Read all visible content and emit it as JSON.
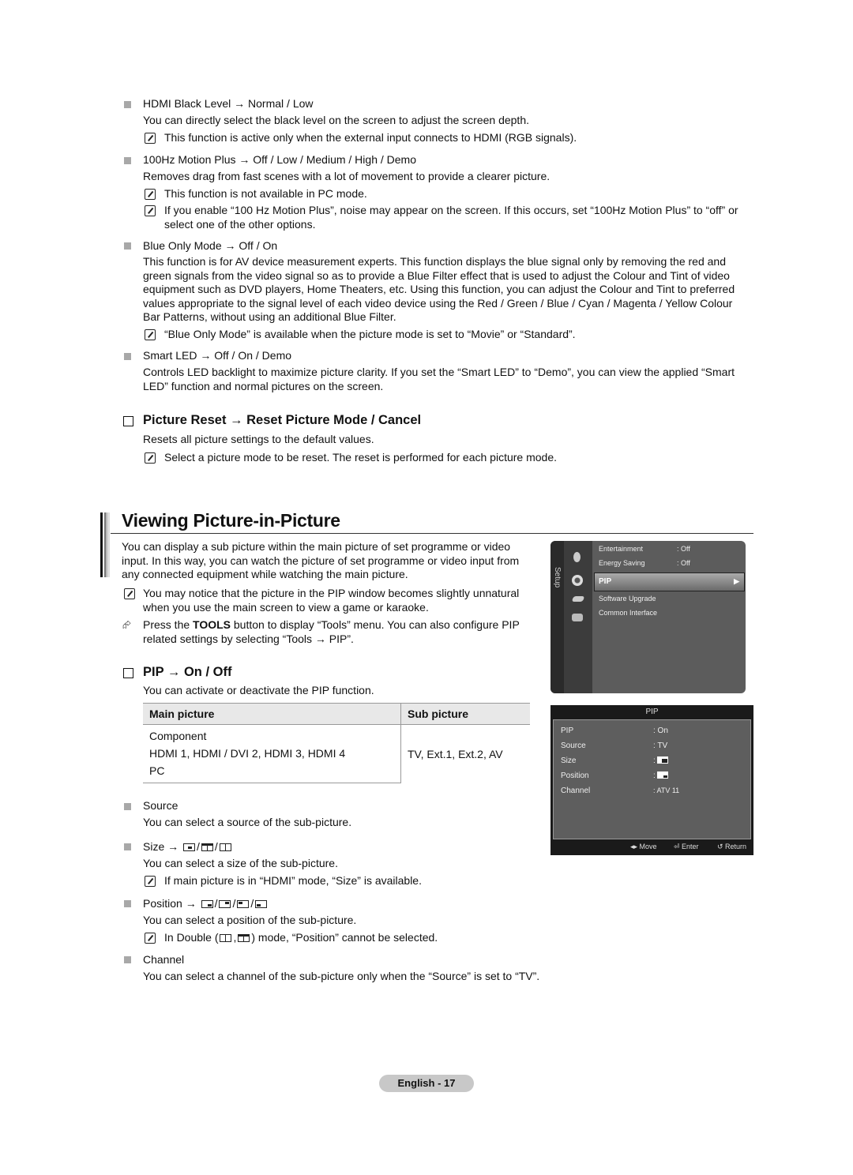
{
  "sections_top": [
    {
      "heading": "HDMI Black Level → Normal / Low",
      "body": "You can directly select the black level on the screen to adjust the screen depth.",
      "notes": [
        "This function is active only when the external input connects to HDMI (RGB signals)."
      ]
    },
    {
      "heading": "100Hz Motion Plus → Off / Low / Medium / High / Demo",
      "body": "Removes drag from fast scenes with a lot of movement to provide a clearer picture.",
      "notes": [
        "This function is not available in PC mode.",
        "If you enable “100 Hz Motion Plus”, noise may appear on the screen. If this occurs, set “100Hz Motion Plus” to “off” or select one of the other options."
      ]
    },
    {
      "heading": "Blue Only Mode → Off / On",
      "body": "This function is for AV device measurement experts. This function displays the blue signal only by removing the red and green signals from the video signal so as to provide a Blue Filter effect that is used to adjust the Colour and Tint of video equipment such as DVD players, Home Theaters, etc. Using this function, you can adjust the Colour and Tint to preferred values appropriate to the signal level of each video device using the Red / Green / Blue / Cyan / Magenta / Yellow Colour Bar Patterns, without using an additional Blue Filter.",
      "notes": [
        "“Blue Only Mode” is available when the picture mode is set to “Movie” or “Standard”."
      ]
    },
    {
      "heading": "Smart LED → Off / On / Demo",
      "body": "Controls LED backlight to maximize picture clarity. If you set the “Smart LED” to “Demo”, you can view the applied “Smart LED” function and normal pictures on the screen.",
      "notes": []
    }
  ],
  "picture_reset": {
    "heading": "Picture Reset → Reset Picture Mode / Cancel",
    "body": "Resets all picture settings to the default values.",
    "note": "Select a picture mode to be reset. The reset is performed for each picture mode."
  },
  "pip_section": {
    "title": "Viewing Picture-in-Picture",
    "intro": "You can display a sub picture within the main picture of set programme or video input. In this way, you can watch the picture of set programme or video input from any connected equipment while watching the main picture.",
    "note": "You may notice that the picture in the PIP window becomes slightly unnatural when you use the main screen to view a game or karaoke.",
    "tools_pre": "Press the ",
    "tools_bold": "TOOLS",
    "tools_post": " button to display “Tools” menu. You can also configure PIP related settings by selecting “Tools → PIP”.",
    "onoff_heading": "PIP → On / Off",
    "onoff_body": "You can activate or deactivate the PIP function.",
    "table": {
      "headers": [
        "Main picture",
        "Sub picture"
      ],
      "main_rows": [
        "Component",
        "HDMI 1, HDMI / DVI 2, HDMI 3, HDMI 4",
        "PC"
      ],
      "sub_value": "TV, Ext.1, Ext.2, AV"
    },
    "source": {
      "heading": "Source",
      "body": "You can select a source of the sub-picture."
    },
    "size": {
      "heading": "Size →",
      "body": "You can select a size of the sub-picture.",
      "note": "If main picture is in “HDMI” mode, “Size” is available."
    },
    "position": {
      "heading": "Position →",
      "body": "You can select a position of the sub-picture.",
      "note_pre": "In Double (",
      "note_post": ") mode, “Position” cannot be selected."
    },
    "channel": {
      "heading": "Channel",
      "body": "You can select a channel of the sub-picture only when the “Source” is set to “TV”."
    }
  },
  "tv_setup_menu": {
    "side_label": "Setup",
    "items": [
      {
        "label": "Entertainment",
        "value": ": Off"
      },
      {
        "label": "Energy Saving",
        "value": ": Off"
      },
      {
        "label": "PIP",
        "value": "▶",
        "selected": true
      },
      {
        "label": "Software Upgrade",
        "value": ""
      },
      {
        "label": "Common Interface",
        "value": ""
      }
    ]
  },
  "tv_pip_menu": {
    "title": "PIP",
    "rows": [
      {
        "label": "PIP",
        "value": ": On"
      },
      {
        "label": "Source",
        "value": ": TV"
      },
      {
        "label": "Size",
        "value": ":"
      },
      {
        "label": "Position",
        "value": ":"
      },
      {
        "label": "Channel",
        "value": ": ATV 11"
      }
    ],
    "footer": {
      "move": "Move",
      "enter": "Enter",
      "return": "Return"
    }
  },
  "page_footer": "English - 17"
}
